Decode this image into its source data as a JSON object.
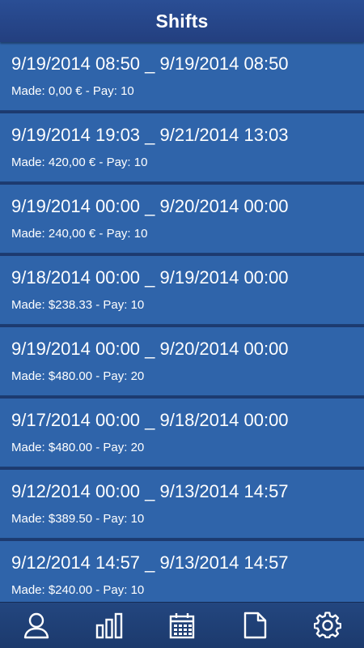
{
  "header": {
    "title": "Shifts"
  },
  "shifts": [
    {
      "range": "9/19/2014 08:50 _ 9/19/2014 08:50",
      "details": "Made: 0,00 € - Pay: 10"
    },
    {
      "range": "9/19/2014 19:03 _ 9/21/2014 13:03",
      "details": "Made: 420,00 € - Pay: 10"
    },
    {
      "range": "9/19/2014 00:00 _ 9/20/2014 00:00",
      "details": "Made: 240,00 € - Pay: 10"
    },
    {
      "range": "9/18/2014 00:00 _ 9/19/2014 00:00",
      "details": "Made: $238.33 - Pay: 10"
    },
    {
      "range": "9/19/2014 00:00 _ 9/20/2014 00:00",
      "details": "Made: $480.00 - Pay: 20"
    },
    {
      "range": "9/17/2014 00:00 _ 9/18/2014 00:00",
      "details": "Made: $480.00 - Pay: 20"
    },
    {
      "range": "9/12/2014 00:00 _ 9/13/2014 14:57",
      "details": "Made: $389.50 - Pay: 10"
    },
    {
      "range": "9/12/2014 14:57 _ 9/13/2014 14:57",
      "details": "Made: $240.00 - Pay: 10"
    }
  ],
  "tabbar": {
    "tabs": [
      {
        "icon": "user-icon"
      },
      {
        "icon": "bar-chart-icon"
      },
      {
        "icon": "calendar-icon"
      },
      {
        "icon": "document-icon"
      },
      {
        "icon": "gear-icon"
      }
    ]
  },
  "colors": {
    "header": "#2a4e95",
    "list_item": "#2f64aa",
    "background": "#1f3f77",
    "tabbar": "#1c3a6d",
    "text": "#ffffff"
  }
}
